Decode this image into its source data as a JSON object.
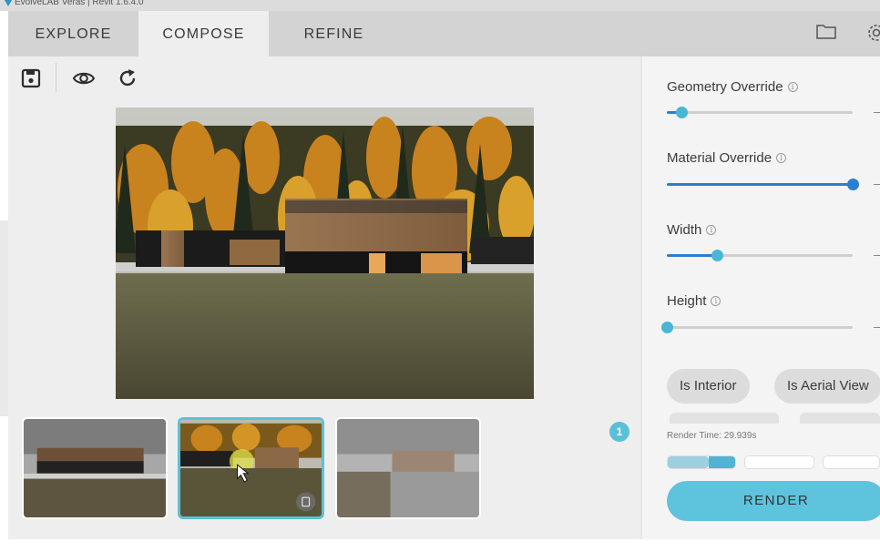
{
  "window": {
    "title": "EvolveLAB Veras | Revit 1.6.4.0"
  },
  "tabs": [
    {
      "label": "EXPLORE",
      "active": false
    },
    {
      "label": "COMPOSE",
      "active": true
    },
    {
      "label": "REFINE",
      "active": false
    }
  ],
  "header_icons": {
    "folder": "folder-icon",
    "settings": "gear-icon"
  },
  "toolbar": {
    "save": "save-icon",
    "preview": "eye-icon",
    "refresh": "refresh-icon"
  },
  "thumbnail_badge": "1",
  "sliders": [
    {
      "label": "Geometry Override",
      "value": 0.08
    },
    {
      "label": "Material Override",
      "value": 1.0
    },
    {
      "label": "Width",
      "value": 0.27
    },
    {
      "label": "Height",
      "value": 0.0
    }
  ],
  "chips": [
    "Is Interior",
    "Is Aerial View"
  ],
  "render_time": "Render Time: 29.939s",
  "render_button": "RENDER",
  "colors": {
    "accent": "#5ec3dc",
    "slider_fill": "#2a7fd0",
    "knob": "#49b6d6",
    "active_tab": "#eeeeee",
    "tab_bar": "#d3d3d3"
  }
}
